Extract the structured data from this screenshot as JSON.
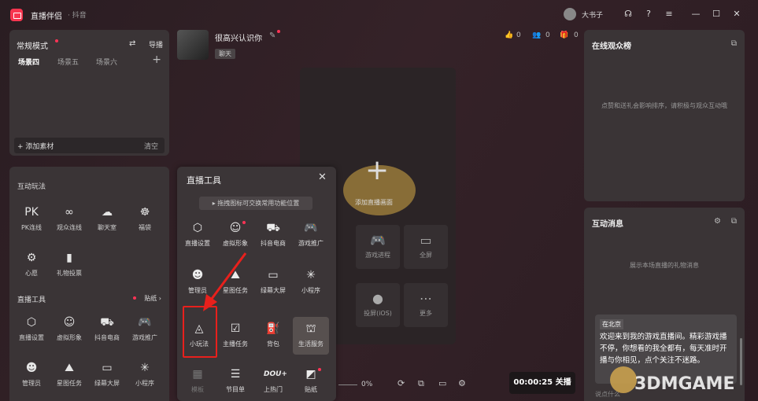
{
  "titlebar": {
    "app_name": "直播伴侣",
    "platform": "· 抖音",
    "user_name": "大书子"
  },
  "left_top": {
    "mode": "常规模式",
    "guide": "导播",
    "scenes": [
      "场景四",
      "场景五",
      "场景六"
    ],
    "add_material": "+ 添加素材",
    "clear": "清空"
  },
  "interact": {
    "section_title": "互动玩法",
    "items": [
      {
        "label": "PK连线",
        "icon": "PK"
      },
      {
        "label": "观众连线",
        "icon": "∞"
      },
      {
        "label": "聊天室",
        "icon": "☁"
      },
      {
        "label": "福袋",
        "icon": "☸"
      },
      {
        "label": "心愿",
        "icon": "⚙"
      },
      {
        "label": "礼物投票",
        "icon": "▮"
      }
    ]
  },
  "tools": {
    "section_title": "直播工具",
    "sticker": "贴纸",
    "items": [
      {
        "label": "直播设置",
        "icon": "⬡"
      },
      {
        "label": "虚拟形象",
        "icon": "☺"
      },
      {
        "label": "抖音电商",
        "icon": "⛟"
      },
      {
        "label": "游戏推广",
        "icon": "🎮"
      },
      {
        "label": "管理员",
        "icon": "☻"
      },
      {
        "label": "星图任务",
        "icon": "⛰"
      },
      {
        "label": "绿幕大屏",
        "icon": "▭"
      },
      {
        "label": "小程序",
        "icon": "✳"
      }
    ]
  },
  "header": {
    "username": "很高兴认识你",
    "tag": "聊天",
    "likes": "0",
    "viewers": "0",
    "gifts": "0"
  },
  "preview": {
    "add_label": "添加直播画面",
    "tiles": [
      {
        "label": "游戏进程",
        "icon": "🎮"
      },
      {
        "label": "全屏",
        "icon": "▭"
      },
      {
        "label": "投屏(iOS)",
        "icon": ""
      },
      {
        "label": "更多",
        "icon": "⋯"
      }
    ]
  },
  "bottom": {
    "volume": "0%",
    "timer": "00:00:25 关播"
  },
  "right_top": {
    "title": "在线观众榜",
    "empty": "点赞和送礼会影响排序，请积极与观众互动哦"
  },
  "right_bottom": {
    "title": "互动消息",
    "empty": "展示本场直播的礼物消息",
    "location": "在北京",
    "message": "欢迎来到我的游戏直播间。精彩游戏播不停，你想看的我全都有，每天准时开播与你相见，点个关注不迷路。",
    "input_placeholder": "说点什么"
  },
  "popup": {
    "title": "直播工具",
    "hint": "拖拽图标可交换常用功能位置",
    "items": [
      {
        "label": "直播设置",
        "icon": "⬡"
      },
      {
        "label": "虚拟形象",
        "icon": "☺"
      },
      {
        "label": "抖音电商",
        "icon": "⛟"
      },
      {
        "label": "游戏推广",
        "icon": "🎮"
      },
      {
        "label": "管理员",
        "icon": "☻"
      },
      {
        "label": "星图任务",
        "icon": "⛰"
      },
      {
        "label": "绿幕大屏",
        "icon": "▭"
      },
      {
        "label": "小程序",
        "icon": "✳"
      },
      {
        "label": "小玩法",
        "icon": "◬"
      },
      {
        "label": "主播任务",
        "icon": "☑"
      },
      {
        "label": "背包",
        "icon": "⛽"
      },
      {
        "label": "生活服务",
        "icon": "⛫"
      },
      {
        "label": "模板",
        "icon": "▦"
      },
      {
        "label": "节目单",
        "icon": "☰"
      },
      {
        "label": "上热门",
        "icon": "DOU+"
      },
      {
        "label": "贴纸",
        "icon": "◩"
      }
    ]
  },
  "watermark": "3DMGAME"
}
